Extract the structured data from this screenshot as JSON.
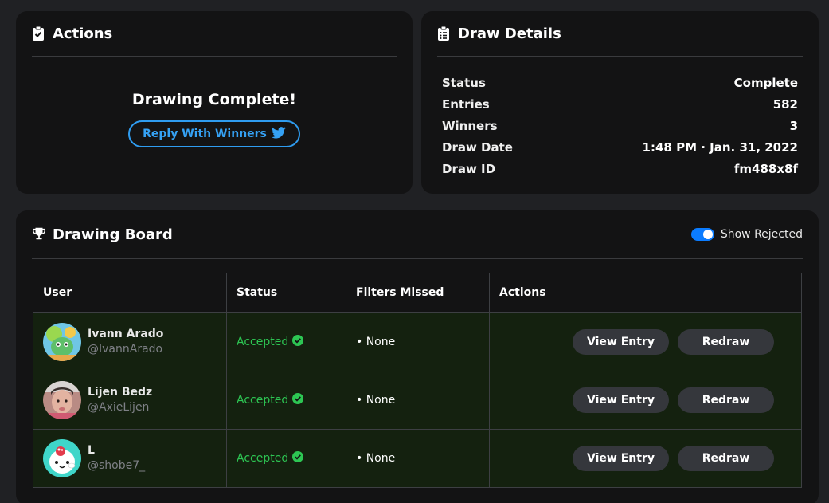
{
  "actions_card": {
    "title": "Actions",
    "complete_text": "Drawing Complete!",
    "reply_button_label": "Reply With Winners"
  },
  "details_card": {
    "title": "Draw Details",
    "rows": [
      {
        "label": "Status",
        "value": "Complete"
      },
      {
        "label": "Entries",
        "value": "582"
      },
      {
        "label": "Winners",
        "value": "3"
      },
      {
        "label": "Draw Date",
        "value": "1:48 PM · Jan. 31, 2022"
      },
      {
        "label": "Draw ID",
        "value": "fm488x8f"
      }
    ]
  },
  "board_card": {
    "title": "Drawing Board",
    "toggle_label": "Show Rejected",
    "toggle_on": true,
    "columns": [
      "User",
      "Status",
      "Filters Missed",
      "Actions"
    ],
    "rows": [
      {
        "name": "Ivann Arado",
        "handle": "@IvannArado",
        "status": "Accepted",
        "filters_missed": "• None",
        "view_label": "View Entry",
        "redraw_label": "Redraw"
      },
      {
        "name": "Lijen Bedz",
        "handle": "@AxieLijen",
        "status": "Accepted",
        "filters_missed": "• None",
        "view_label": "View Entry",
        "redraw_label": "Redraw"
      },
      {
        "name": "L",
        "handle": "@shobe7_",
        "status": "Accepted",
        "filters_missed": "• None",
        "view_label": "View Entry",
        "redraw_label": "Redraw"
      }
    ]
  },
  "colors": {
    "background": "#202124",
    "card": "#131314",
    "accent_blue": "#2f9cf0",
    "accepted_green": "#2dc653",
    "row_bg": "#14210f",
    "pill_bg": "#35373c"
  },
  "icons": [
    "clipboard-check-icon",
    "clipboard-list-icon",
    "trophy-icon",
    "twitter-icon",
    "check-circle-icon"
  ]
}
